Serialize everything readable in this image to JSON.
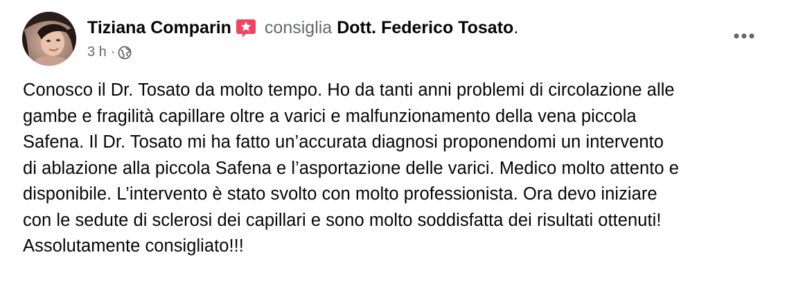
{
  "post": {
    "author_name": "Tiziana Comparin",
    "action_text": "consiglia",
    "target_name": "Dott. Federico Tosato",
    "punctuation": ".",
    "timestamp": "3 h",
    "separator": "·",
    "privacy_icon": "globe-icon",
    "badge_icon": "recommend-star-icon",
    "more_icon": "more-options-icon",
    "text": "Conosco il Dr. Tosato da molto tempo. Ho da tanti anni problemi di circolazione alle\ngambe e fragilità capillare oltre a varici e malfunzionamento della vena piccola\nSafena. Il Dr. Tosato mi ha fatto un’accurata diagnosi proponendomi un intervento\ndi ablazione alla piccola Safena e l’asportazione delle varici. Medico molto attento e\ndisponibile. L’intervento è stato svolto con molto professionista. Ora devo iniziare\ncon le sedute di sclerosi dei capillari e sono molto soddisfatta dei risultati ottenuti!\nAssolutamente consigliato!!!"
  },
  "colors": {
    "badge": "#f3425f",
    "secondary_text": "#65676b",
    "primary_text": "#050505"
  }
}
